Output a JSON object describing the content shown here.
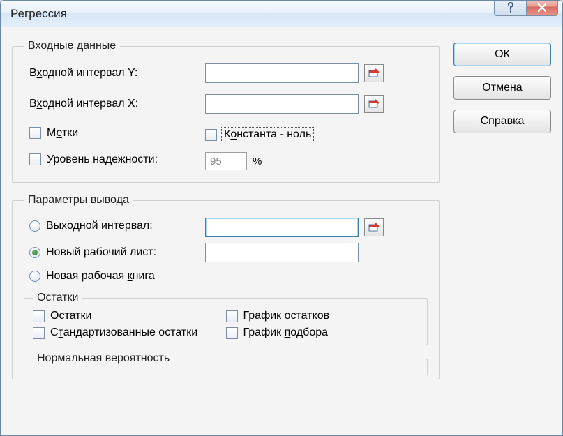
{
  "window": {
    "title": "Регрессия"
  },
  "buttons": {
    "ok": "ОК",
    "cancel": "Отмена",
    "help": "Справка"
  },
  "input_group": {
    "legend": "Входные данные",
    "y_label_pre": "В",
    "y_label_mid": "х",
    "y_label_post": "одной интервал Y:",
    "x_label_pre": "В",
    "x_label_mid": "х",
    "x_label_post": "одной интервал X:",
    "y_value": "",
    "x_value": "",
    "labels_pre": "М",
    "labels_mid": "е",
    "labels_post": "тки",
    "const_zero_pre": "К",
    "const_zero_mid": "о",
    "const_zero_post": "нстанта - ноль",
    "conf_label": "Уровень надежности:",
    "conf_value": "95",
    "pct": "%"
  },
  "output_group": {
    "legend": "Параметры вывода",
    "out_range": "Выходной интервал:",
    "out_range_value": "",
    "new_sheet": "Новый рабочий лист:",
    "new_sheet_value": "",
    "new_book_pre": "Новая рабочая ",
    "new_book_mid": "к",
    "new_book_post": "нига"
  },
  "residuals_group": {
    "legend": "Остатки",
    "residuals": "Остатки",
    "std_res_pre": "С",
    "std_res_mid": "т",
    "std_res_post": "андартизованные остатки",
    "res_plot": "График остатков",
    "fit_plot_pre": "График ",
    "fit_plot_mid": "п",
    "fit_plot_post": "одбора"
  },
  "normal_group": {
    "legend": "Нормальная вероятность"
  }
}
